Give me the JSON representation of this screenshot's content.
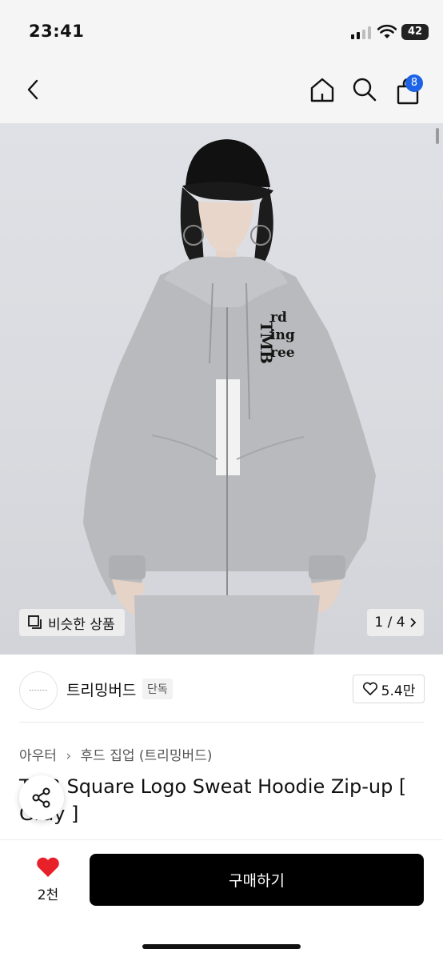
{
  "status_bar": {
    "time": "23:41",
    "battery": "42"
  },
  "nav": {
    "cart_count": "8"
  },
  "hero": {
    "similar_label": "비슷한 상품",
    "page_indicator": "1 / 4"
  },
  "brand": {
    "name": "트리밍버드",
    "exclusive_badge": "단독",
    "likes": "5.4만"
  },
  "breadcrumb": {
    "category": "아우터",
    "subcategory": "후드 집업 (트리밍버드)"
  },
  "product": {
    "title": "TMB Square Logo Sweat Hoodie Zip-up [ Gray ]"
  },
  "hoodie_print": {
    "line1": "rd",
    "line2": "ing",
    "line3": "ree",
    "vertical": "TMB"
  },
  "bottom": {
    "wish_count": "2천",
    "buy_label": "구매하기"
  },
  "colors": {
    "accent": "#1c63e6",
    "wish_heart": "#e8202a",
    "buy_button": "#000000"
  }
}
